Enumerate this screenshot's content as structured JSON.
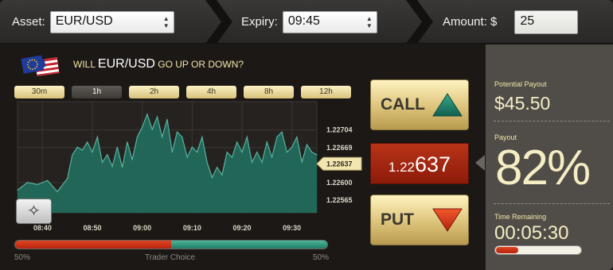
{
  "topbar": {
    "asset_label": "Asset:",
    "asset_value": "EUR/USD",
    "expiry_label": "Expiry:",
    "expiry_value": "09:45",
    "amount_label": "Amount: $",
    "amount_value": "25"
  },
  "question": {
    "prefix": "WILL ",
    "pair": "EUR/USD",
    "suffix": " GO UP OR DOWN?"
  },
  "timeframes": [
    {
      "label": "30m",
      "active": false
    },
    {
      "label": "1h",
      "active": true
    },
    {
      "label": "2h",
      "active": false
    },
    {
      "label": "4h",
      "active": false
    },
    {
      "label": "8h",
      "active": false
    },
    {
      "label": "12h",
      "active": false
    }
  ],
  "chart_data": {
    "type": "area",
    "x_ticks": [
      "08:40",
      "08:50",
      "09:00",
      "09:10",
      "09:20",
      "09:30"
    ],
    "y_ticks": [
      "1.22704",
      "1.22669",
      "1.22600",
      "1.22565"
    ],
    "ylim": [
      1.2254,
      1.2276
    ],
    "current_price_tag": "1.22637",
    "x": [
      "08:35",
      "08:37",
      "08:39",
      "08:41",
      "08:43",
      "08:45",
      "08:46",
      "08:47",
      "08:48",
      "08:49",
      "08:50",
      "08:51",
      "08:52",
      "08:53",
      "08:54",
      "08:55",
      "08:56",
      "08:57",
      "08:58",
      "08:59",
      "09:00",
      "09:01",
      "09:02",
      "09:03",
      "09:04",
      "09:05",
      "09:06",
      "09:07",
      "09:08",
      "09:09",
      "09:10",
      "09:11",
      "09:12",
      "09:13",
      "09:14",
      "09:15",
      "09:16",
      "09:17",
      "09:18",
      "09:19",
      "09:20",
      "09:21",
      "09:22",
      "09:23",
      "09:24",
      "09:25",
      "09:26",
      "09:27",
      "09:28",
      "09:29",
      "09:30",
      "09:31",
      "09:32",
      "09:33",
      "09:34",
      "09:35"
    ],
    "values": [
      1.22585,
      1.226,
      1.22596,
      1.22604,
      1.22582,
      1.22608,
      1.22655,
      1.2267,
      1.22664,
      1.2268,
      1.2266,
      1.2269,
      1.2264,
      1.22655,
      1.22632,
      1.2267,
      1.2263,
      1.2268,
      1.22645,
      1.2269,
      1.2271,
      1.22735,
      1.22705,
      1.2273,
      1.2269,
      1.22725,
      1.2266,
      1.227,
      1.2269,
      1.2265,
      1.2267,
      1.2266,
      1.2269,
      1.2264,
      1.2261,
      1.2263,
      1.22615,
      1.2266,
      1.2265,
      1.2268,
      1.2266,
      1.2269,
      1.2264,
      1.2266,
      1.2264,
      1.2268,
      1.2265,
      1.2269,
      1.227,
      1.2266,
      1.2267,
      1.2269,
      1.2264,
      1.22675,
      1.2266,
      1.22655
    ],
    "line_color": "#58b3a0",
    "fill_color": "#226a5c"
  },
  "sentiment": {
    "put_percent": 50,
    "call_percent": 50,
    "left_label": "50%",
    "center_label": "Trader Choice",
    "right_label": "50%"
  },
  "buttons": {
    "call_label": "CALL",
    "put_label": "PUT"
  },
  "price": {
    "prefix": "1.22",
    "suffix": "637"
  },
  "panel": {
    "potential_payout_label": "Potential Payout",
    "potential_payout_value": "$45.50",
    "payout_label": "Payout",
    "payout_value": "82%",
    "time_remaining_label": "Time Remaining",
    "time_remaining_value": "00:05:30",
    "time_remaining_fraction": 0.26
  },
  "colors": {
    "accent_gold": "#f1e6a6",
    "call_green": "#1e7d68",
    "put_red": "#e04420"
  }
}
